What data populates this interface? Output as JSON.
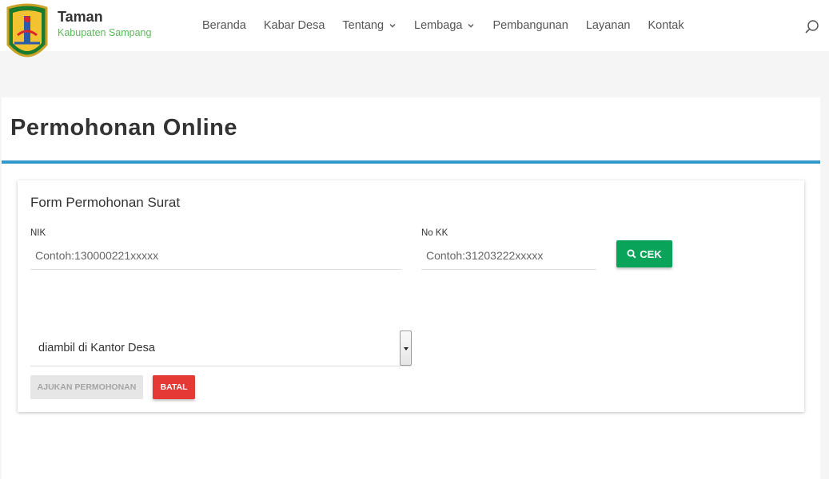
{
  "header": {
    "site_title": "Taman",
    "site_subtitle": "Kabupaten Sampang",
    "nav": [
      {
        "label": "Beranda"
      },
      {
        "label": "Kabar Desa"
      },
      {
        "label": "Tentang"
      },
      {
        "label": "Lembaga"
      },
      {
        "label": "Pembangunan"
      },
      {
        "label": "Layanan"
      },
      {
        "label": "Kontak"
      }
    ]
  },
  "page": {
    "title": "Permohonan Online"
  },
  "form": {
    "title": "Form Permohonan Surat",
    "nik_label": "NIK",
    "nik_placeholder": "Contoh:130000221xxxxx",
    "kk_label": "No KK",
    "kk_placeholder": "Contoh:31203222xxxxx",
    "cek_label": "CEK",
    "pickup_selected": "diambil di Kantor Desa",
    "submit_label": "AJUKAN PERMOHONAN",
    "cancel_label": "BATAL"
  },
  "colors": {
    "accent_blue": "#3399cc",
    "cek_green": "#0aa35a",
    "batal_red": "#e53935",
    "subtitle_green": "#5cb85c"
  }
}
